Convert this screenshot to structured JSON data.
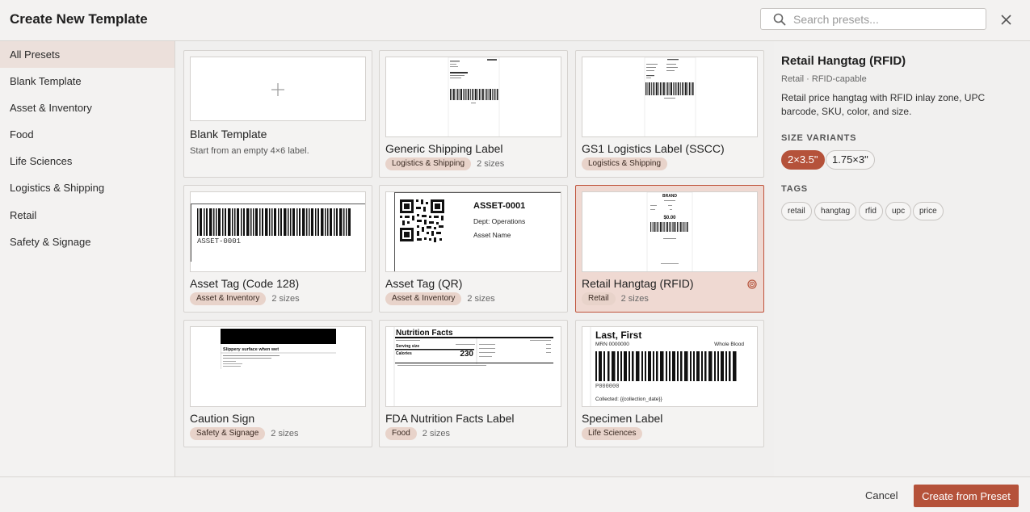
{
  "header": {
    "title": "Create New Template",
    "search_placeholder": "Search presets...",
    "search_value": ""
  },
  "sidebar": {
    "items": [
      {
        "label": "All Presets",
        "active": true
      },
      {
        "label": "Blank Template"
      },
      {
        "label": "Asset & Inventory"
      },
      {
        "label": "Food"
      },
      {
        "label": "Life Sciences"
      },
      {
        "label": "Logistics & Shipping"
      },
      {
        "label": "Retail"
      },
      {
        "label": "Safety & Signage"
      }
    ]
  },
  "presets": [
    {
      "name": "Blank Template",
      "description": "Start from an empty 4×6 label."
    },
    {
      "name": "Generic Shipping Label",
      "category": "Logistics & Shipping",
      "sizes": "2 sizes"
    },
    {
      "name": "GS1 Logistics Label (SSCC)",
      "category": "Logistics & Shipping"
    },
    {
      "name": "Asset Tag (Code 128)",
      "category": "Asset & Inventory",
      "sizes": "2 sizes",
      "thumb_text": "ASSET-0001"
    },
    {
      "name": "Asset Tag (QR)",
      "category": "Asset & Inventory",
      "sizes": "2 sizes",
      "thumb_id": "ASSET-0001",
      "thumb_dept": "Dept: Operations",
      "thumb_asset": "Asset Name"
    },
    {
      "name": "Retail Hangtag (RFID)",
      "category": "Retail",
      "sizes": "2 sizes",
      "selected": true,
      "thumb_brand": "BRAND",
      "thumb_price": "$0.00"
    },
    {
      "name": "Caution Sign",
      "category": "Safety & Signage",
      "sizes": "2 sizes",
      "thumb_heading": "Slippery surface when wet"
    },
    {
      "name": "FDA Nutrition Facts Label",
      "category": "Food",
      "sizes": "2 sizes",
      "thumb_heading": "Nutrition Facts",
      "thumb_serving": "Serving size",
      "thumb_calories": "Calories",
      "thumb_cal_value": "230"
    },
    {
      "name": "Specimen Label",
      "category": "Life Sciences",
      "thumb_name": "Last, First",
      "thumb_mrn": "MRN 0000000",
      "thumb_type": "Whole Blood",
      "thumb_code": "P000000",
      "thumb_collected": "Collected: {{collection_date}}"
    }
  ],
  "detail": {
    "title": "Retail Hangtag (RFID)",
    "subtitle": "Retail · RFID-capable",
    "description": "Retail price hangtag with RFID inlay zone, UPC barcode, SKU, color, and size.",
    "variants_heading": "SIZE VARIANTS",
    "variants": [
      "2×3.5\"",
      "1.75×3\""
    ],
    "tags_heading": "TAGS",
    "tags": [
      "retail",
      "hangtag",
      "rfid",
      "upc",
      "price"
    ]
  },
  "footer": {
    "cancel_label": "Cancel",
    "create_label": "Create from Preset"
  },
  "colors": {
    "accent": "#b5523a",
    "selected_bg": "#efd9d2",
    "pill_bg": "#e8d3ca"
  }
}
